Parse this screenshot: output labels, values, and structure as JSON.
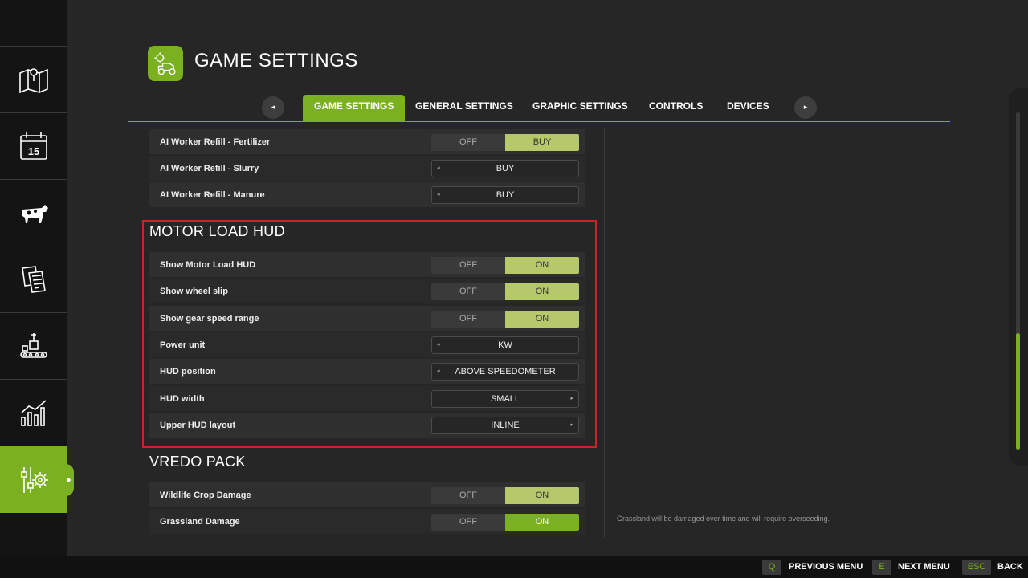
{
  "header": {
    "title": "GAME SETTINGS",
    "icon": "tractor-gear-icon"
  },
  "tabs": {
    "items": [
      {
        "label": "GAME SETTINGS",
        "active": true
      },
      {
        "label": "GENERAL SETTINGS"
      },
      {
        "label": "GRAPHIC SETTINGS"
      },
      {
        "label": "CONTROLS"
      },
      {
        "label": "DEVICES"
      }
    ],
    "prev_arrow": "◂",
    "next_arrow": "▸"
  },
  "sidebar": {
    "items": [
      "map-icon",
      "calendar-icon",
      "animals-icon",
      "contracts-icon",
      "production-icon",
      "statistics-icon",
      "settings-icon"
    ],
    "calendar_day": "15",
    "active": "settings-icon"
  },
  "rows_top": [
    {
      "label": "AI Worker Refill - Fertilizer",
      "type": "toggle",
      "off": "OFF",
      "on": "BUY",
      "value": "BUY"
    },
    {
      "label": "AI Worker Refill - Slurry",
      "type": "selector",
      "value": "BUY"
    },
    {
      "label": "AI Worker Refill - Manure",
      "type": "selector",
      "value": "BUY"
    }
  ],
  "motor_section": {
    "title": "MOTOR LOAD HUD",
    "rows": [
      {
        "label": "Show Motor Load HUD",
        "off": "OFF",
        "on": "ON",
        "value": "ON"
      },
      {
        "label": "Show wheel slip",
        "off": "OFF",
        "on": "ON",
        "value": "ON"
      },
      {
        "label": "Show gear speed range",
        "off": "OFF",
        "on": "ON",
        "value": "ON"
      },
      {
        "label": "Power unit",
        "value": "KW"
      },
      {
        "label": "HUD position",
        "value": "ABOVE SPEEDOMETER"
      },
      {
        "label": "HUD width",
        "value": "SMALL"
      },
      {
        "label": "Upper HUD layout",
        "value": "INLINE"
      }
    ]
  },
  "vredo_section": {
    "title": "VREDO PACK",
    "rows": [
      {
        "label": "Wildlife Crop Damage",
        "off": "OFF",
        "on": "ON",
        "value": "ON"
      },
      {
        "label": "Grassland Damage",
        "off": "OFF",
        "on": "ON",
        "value": "ON"
      }
    ]
  },
  "help_text": "Grassland will be damaged over time and will require overseeding.",
  "footer": {
    "prev": {
      "key": "Q",
      "label": "PREVIOUS MENU"
    },
    "next": {
      "key": "E",
      "label": "NEXT MENU"
    },
    "back": {
      "key": "ESC",
      "label": "BACK"
    }
  },
  "colors": {
    "accent": "#7bb021",
    "toggle_on": "#b6c96a",
    "highlight": "#d0202a"
  },
  "scroll_position": 0.7
}
